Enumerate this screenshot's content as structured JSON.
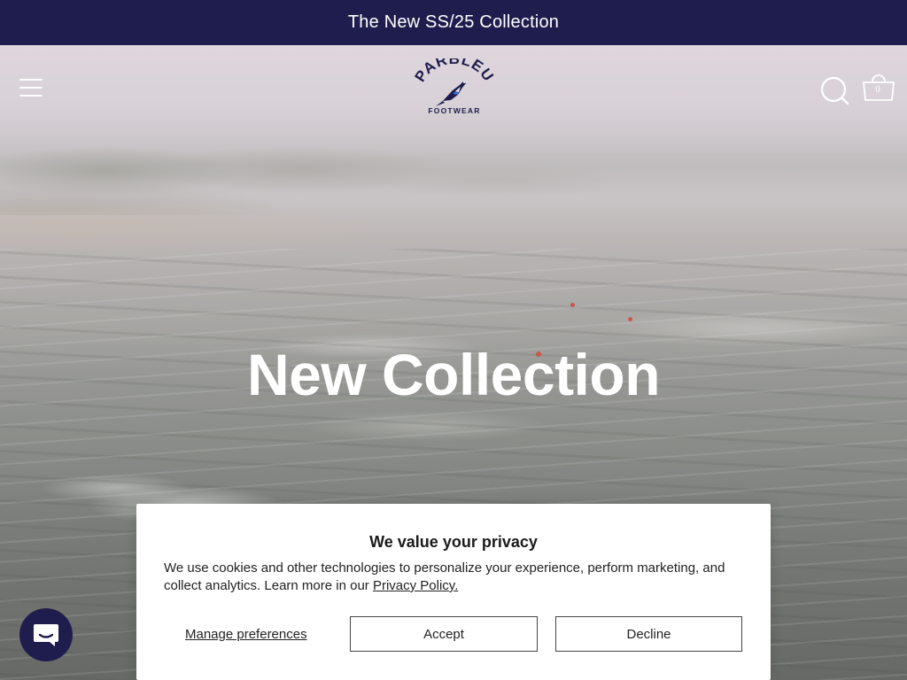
{
  "announcement": {
    "text": "The New SS/25 Collection"
  },
  "header": {
    "menu_icon": "hamburger-menu-icon",
    "logo": {
      "wordmark": "PARBLEU",
      "tagline": "FOOTWEAR",
      "bird_icon": "magpie-bird-icon"
    },
    "search_icon": "search-icon",
    "cart_icon": "cart-icon",
    "cart_count": "0"
  },
  "hero": {
    "title": "New Collection"
  },
  "chat": {
    "icon": "chat-bubble-icon"
  },
  "privacy": {
    "title": "We value your privacy",
    "body": "We use cookies and other technologies to personalize your experience, perform marketing, and collect analytics. Learn more in our",
    "link": "Privacy Policy.",
    "manage_label": "Manage preferences",
    "accept_label": "Accept",
    "decline_label": "Decline"
  },
  "colors": {
    "brand_navy": "#1e1d4d",
    "white": "#ffffff"
  }
}
